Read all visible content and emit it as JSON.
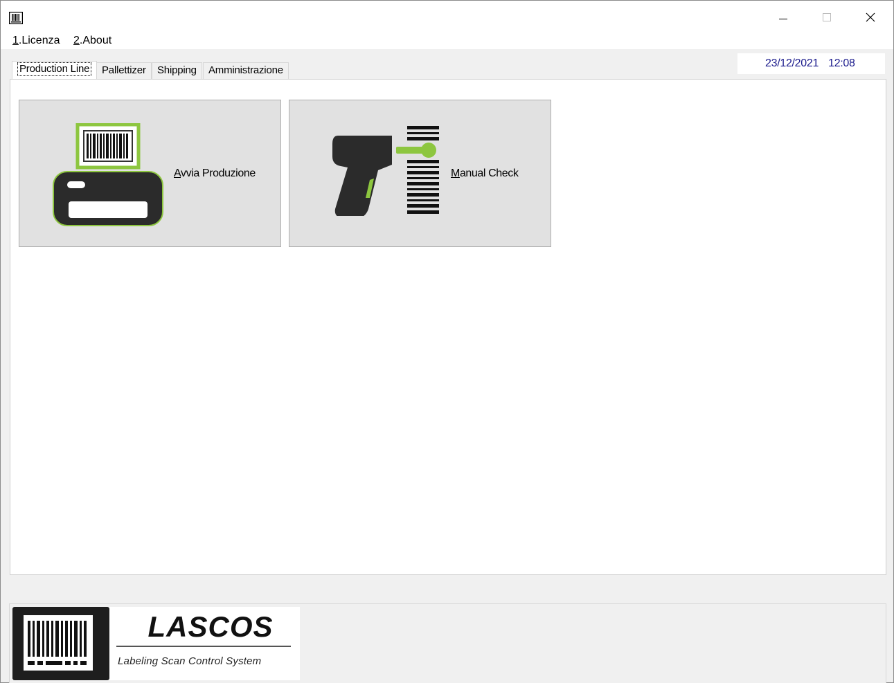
{
  "window": {
    "icon": "barcode-app-icon",
    "controls": [
      "minimize-icon",
      "maximize-icon",
      "close-icon"
    ]
  },
  "menu": {
    "items": [
      {
        "accel": "1",
        "rest": ".Licenza"
      },
      {
        "accel": "2",
        "rest": ".About"
      }
    ]
  },
  "tabs": {
    "items": [
      {
        "label": "Production Line",
        "active": true
      },
      {
        "label": "Pallettizer",
        "active": false
      },
      {
        "label": "Shipping",
        "active": false
      },
      {
        "label": "Amministrazione",
        "active": false
      }
    ]
  },
  "datetime": {
    "date": "23/12/2021",
    "time": "12:08"
  },
  "buttons": {
    "avvia": {
      "accel": "A",
      "rest": "vvia Produzione",
      "icon": "label-printer-icon"
    },
    "manual": {
      "accel": "M",
      "rest": "anual Check",
      "icon": "barcode-scanner-icon"
    }
  },
  "logo": {
    "title": "LASCOS",
    "subtitle": "Labeling Scan Control System",
    "icon": "barcode-logo-icon"
  },
  "colors": {
    "accent_green": "#8dc63f",
    "dark_icon": "#2b2b2b",
    "date_text": "#1a1a8c"
  }
}
